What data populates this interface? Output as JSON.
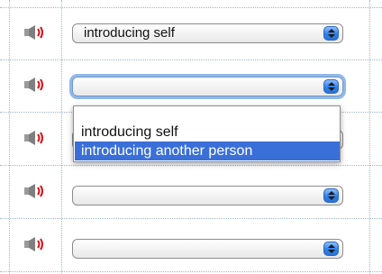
{
  "rows": [
    {
      "select_value": "introducing self",
      "icon": "speaker-icon"
    },
    {
      "select_value": "",
      "icon": "speaker-icon"
    },
    {
      "select_value": "",
      "icon": "speaker-icon"
    },
    {
      "select_value": "",
      "icon": "speaker-icon"
    },
    {
      "select_value": "",
      "icon": "speaker-icon"
    }
  ],
  "dropdown": {
    "options": [
      "introducing self",
      "introducing another person"
    ],
    "highlighted_index": 1
  },
  "colors": {
    "grid": "#9fb7c7",
    "highlight": "#3a6fd8",
    "speaker_red": "#d8101a"
  }
}
